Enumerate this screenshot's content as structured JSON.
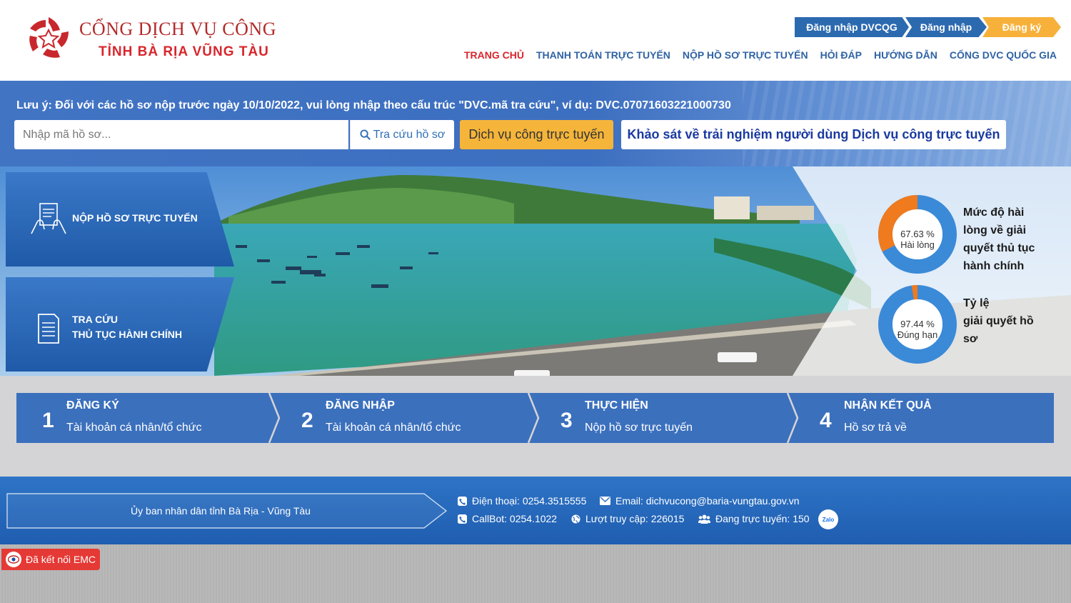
{
  "header": {
    "brand_line1": "CỔNG DỊCH VỤ CÔNG",
    "brand_line2": "TỈNH BÀ RỊA VŨNG TÀU",
    "auth": {
      "dvcqg": "Đăng nhập DVCQG",
      "login": "Đăng nhập",
      "register": "Đăng ký"
    },
    "nav": [
      {
        "label": "TRANG CHỦ",
        "active": true
      },
      {
        "label": "THANH TOÁN TRỰC TUYẾN"
      },
      {
        "label": "NỘP HỒ SƠ TRỰC TUYẾN"
      },
      {
        "label": "HỎI ĐÁP"
      },
      {
        "label": "HƯỚNG DẪN"
      },
      {
        "label": "CỔNG DVC QUỐC GIA"
      }
    ]
  },
  "search": {
    "notice": "Lưu ý: Đối với các hồ sơ nộp trước ngày 10/10/2022, vui lòng nhập theo cấu trúc \"DVC.mã tra cứu\", ví dụ: DVC.07071603221000730",
    "placeholder": "Nhập mã hồ sơ...",
    "search_button": "Tra cứu hồ sơ",
    "dvc_button": "Dịch vụ công trực tuyến",
    "survey_button": "Khảo sát về trải nghiệm người dùng Dịch vụ công trực tuyến"
  },
  "banner": {
    "left_blocks": [
      {
        "label": "NỘP HỒ SƠ TRỰC TUYẾN",
        "icon": "document-hand-icon"
      },
      {
        "label_line1": "TRA CỨU",
        "label_line2": "THỦ TỤC HÀNH CHÍNH",
        "icon": "document-list-icon"
      }
    ],
    "stats": [
      {
        "percent_text": "67.63 %",
        "caption": "Hài lòng",
        "value": 67.63,
        "label_lines": [
          "Mức độ hài",
          "lòng về giải",
          "quyết thủ tục",
          "hành chính"
        ]
      },
      {
        "percent_text": "97.44 %",
        "caption": "Đúng hạn",
        "value": 97.44,
        "label_lines": [
          "Tỷ lệ",
          "giải quyết hồ",
          "sơ"
        ]
      }
    ],
    "colors": {
      "donut_main": "#3a8ad8",
      "donut_rest": "#f07a1e"
    }
  },
  "steps": [
    {
      "num": "1",
      "title": "ĐĂNG KÝ",
      "sub": "Tài khoản cá nhân/tổ chức"
    },
    {
      "num": "2",
      "title": "ĐĂNG NHẬP",
      "sub": "Tài khoản cá nhân/tổ chức"
    },
    {
      "num": "3",
      "title": "THỰC HIỆN",
      "sub": "Nộp hồ sơ trực tuyến"
    },
    {
      "num": "4",
      "title": "NHẬN KẾT QUẢ",
      "sub": "Hồ sơ trả về"
    }
  ],
  "footer": {
    "org": "Ủy ban nhân dân tỉnh Bà Rịa - Vũng Tàu",
    "phone": "Điện thoại: 0254.3515555",
    "email": "Email: dichvucong@baria-vungtau.gov.vn",
    "callbot": "CallBot: 0254.1022",
    "visits": "Lượt truy cập: 226015",
    "online": "Đang trực tuyến: 150",
    "zalo": "Zalo"
  },
  "emc": {
    "label": "Đã kết nối EMC"
  }
}
